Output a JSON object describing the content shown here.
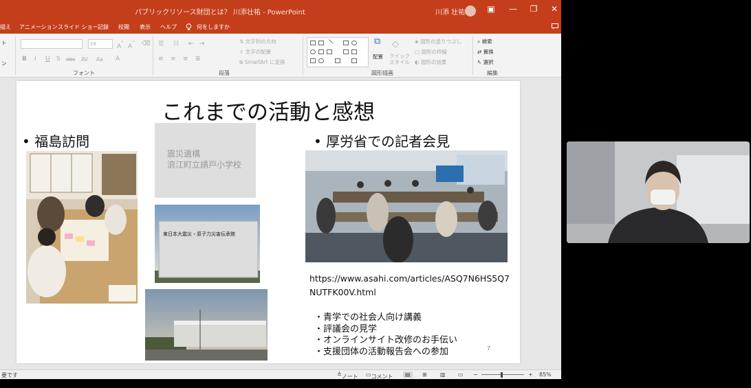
{
  "window": {
    "title": "パブリックリソース財団とは？ 川添壮祐 - PowerPoint",
    "user": "川添 壮祐",
    "minimize": "—",
    "restore": "❐",
    "close": "✕",
    "ribbon_display": "▣"
  },
  "menu": {
    "items": [
      "描え",
      "アニメーション",
      "スライド ショー",
      "記録",
      "校閲",
      "表示",
      "ヘルプ"
    ],
    "search": "何をしますか",
    "search_icon": "lightbulb-icon",
    "comment_icon": "comment-icon"
  },
  "ribbon": {
    "font_group": "フォント",
    "paragraph_group": "段落",
    "drawing_group": "図形描画",
    "editing_group": "編集",
    "font_size": "28",
    "font_buttons": [
      "B",
      "I",
      "U",
      "S",
      "abc",
      "AV",
      "Aa",
      "A"
    ],
    "text_direction": "文字列の方向",
    "text_align": "文字の配置",
    "smartart": "SmartArt に変換",
    "arrange": "配置",
    "quick_styles": "クイック スタイル",
    "shape_fill": "図形の塗りつぶし",
    "shape_outline": "図形の枠線",
    "shape_effects": "図形の効果",
    "find": "検索",
    "replace": "置換",
    "select": "選択",
    "left_stub_1": "ト",
    "left_stub_2": "ン"
  },
  "slide": {
    "title": "これまでの活動と感想",
    "bullet_left": "•  福島訪問",
    "bullet_right": "•  厚労省での記者会見",
    "sign1_line1": "震災遺構",
    "sign1_line2": "浪江町立請戸小学校",
    "sign2": "東日本大震災・原子力災害伝承館",
    "url": "https://www.asahi.com/articles/ASQ7N6HS5Q7NUTFK00V.html",
    "activities": [
      "・青学での社会人向け講義",
      "・評議会の見学",
      "・オンラインサイト改修のお手伝い",
      "・支援団体の活動報告会への参加"
    ],
    "page_number": "7"
  },
  "status": {
    "left": "要です",
    "notes": "ノート",
    "comments": "コメント",
    "zoom": "85%",
    "zoom_minus": "−",
    "zoom_plus": "+"
  }
}
